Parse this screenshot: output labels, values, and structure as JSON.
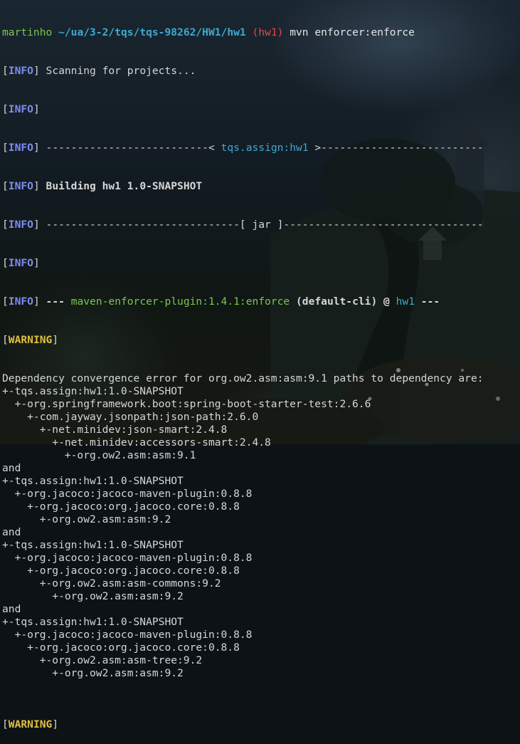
{
  "prompt": {
    "user": "martinho",
    "path": "~/ua/3-2/tqs/tqs-98262/HW1/hw1",
    "branch": "(hw1)",
    "command": "mvn enforcer:enforce"
  },
  "tags": {
    "info": "INFO",
    "warning": "WARNING"
  },
  "log": {
    "scanning": "Scanning for projects...",
    "dashes_left": "--------------------------<",
    "artifact": "tqs.assign:hw1",
    "dashes_right": ">--------------------------",
    "building": "Building hw1 1.0-SNAPSHOT",
    "jar_line": "-------------------------------[ jar ]--------------------------------",
    "plugin_prefix": "---",
    "plugin": "maven-enforcer-plugin:1.4.1:enforce",
    "execution": "(default-cli)",
    "at": "@",
    "module": "hw1",
    "plugin_suffix": "---"
  },
  "output": {
    "lines": [
      "Dependency convergence error for org.ow2.asm:asm:9.1 paths to dependency are:",
      "+-tqs.assign:hw1:1.0-SNAPSHOT",
      "  +-org.springframework.boot:spring-boot-starter-test:2.6.6",
      "    +-com.jayway.jsonpath:json-path:2.6.0",
      "      +-net.minidev:json-smart:2.4.8",
      "        +-net.minidev:accessors-smart:2.4.8",
      "          +-org.ow2.asm:asm:9.1",
      "and",
      "+-tqs.assign:hw1:1.0-SNAPSHOT",
      "  +-org.jacoco:jacoco-maven-plugin:0.8.8",
      "    +-org.jacoco:org.jacoco.core:0.8.8",
      "      +-org.ow2.asm:asm:9.2",
      "and",
      "+-tqs.assign:hw1:1.0-SNAPSHOT",
      "  +-org.jacoco:jacoco-maven-plugin:0.8.8",
      "    +-org.jacoco:org.jacoco.core:0.8.8",
      "      +-org.ow2.asm:asm-commons:9.2",
      "        +-org.ow2.asm:asm:9.2",
      "and",
      "+-tqs.assign:hw1:1.0-SNAPSHOT",
      "  +-org.jacoco:jacoco-maven-plugin:0.8.8",
      "    +-org.jacoco:org.jacoco.core:0.8.8",
      "      +-org.ow2.asm:asm-tree:9.2",
      "        +-org.ow2.asm:asm:9.2",
      ""
    ]
  },
  "colors": {
    "info": "#7d8cf0",
    "warning": "#e0c040",
    "prompt_user": "#78c850",
    "prompt_path": "#3fa9d0",
    "branch": "#e04848",
    "text": "#d6d6d6"
  }
}
